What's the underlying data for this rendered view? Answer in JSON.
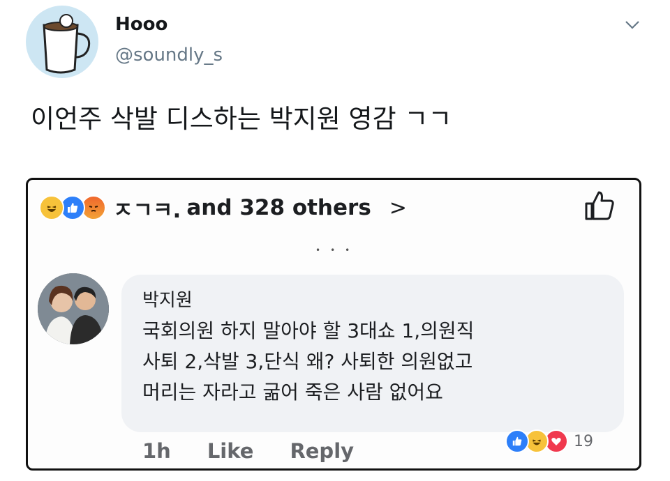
{
  "user": {
    "name": "Hooo",
    "handle": "@soundly_s"
  },
  "tweet": {
    "text": "이언주 삭발 디스하는 박지원 영감 ㄱㄱ"
  },
  "fb": {
    "reactors": "ㅈㄱㅋ.",
    "others": "and 328 others",
    "comment": {
      "author": "박지원",
      "lines": [
        "국회의원 하지 말아야 할 3대쇼  1,의원직",
        "사퇴 2,삭발 3,단식 왜? 사퇴한 의원없고",
        "머리는 자라고 굶어 죽은 사람 없어요"
      ],
      "time": "1h",
      "like": "Like",
      "reply": "Reply",
      "reaction_count": "19"
    }
  },
  "icons": [
    "chevron-down-icon",
    "haha-reaction-icon",
    "like-reaction-icon",
    "angry-reaction-icon",
    "love-reaction-icon",
    "thumbs-up-icon"
  ]
}
